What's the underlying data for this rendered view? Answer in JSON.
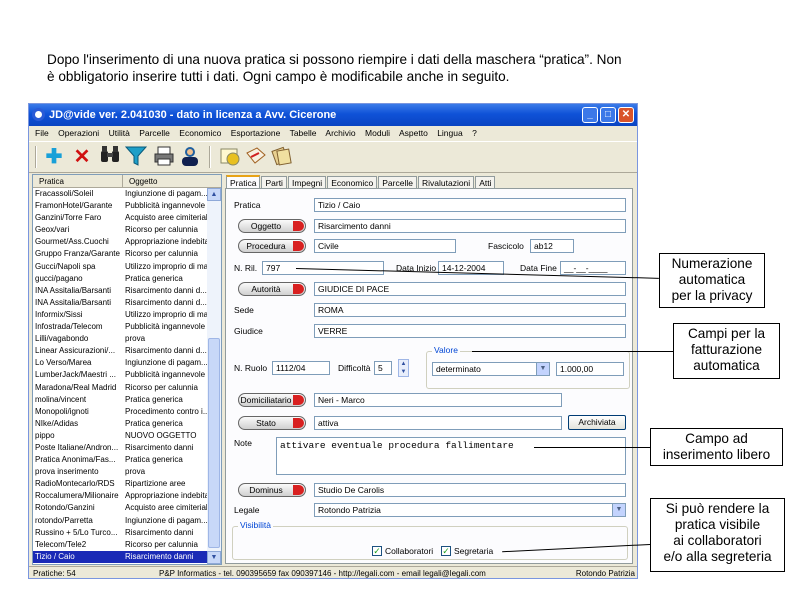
{
  "intro": {
    "line1": "Dopo l'inserimento di una nuova pratica si possono riempire i dati della maschera “pratica”. Non",
    "line2": "è obbligatorio inserire tutti i dati. Ogni campo è modificabile anche in seguito."
  },
  "window": {
    "title": "JD@vide ver. 2.041030 - dato in licenza a Avv. Cicerone",
    "menu": [
      "File",
      "Operazioni",
      "Utilità",
      "Parcelle",
      "Economico",
      "Esportazione",
      "Tabelle",
      "Archivio",
      "Moduli",
      "Aspetto",
      "Lingua",
      "?"
    ]
  },
  "toolbar": {
    "icons": [
      "add-icon",
      "delete-icon",
      "binoculars-icon",
      "filter-icon",
      "print-icon",
      "user-icon",
      "calendar-icon",
      "documents-icon",
      "notes-icon"
    ]
  },
  "list": {
    "headers": [
      "Pratica",
      "Oggetto"
    ],
    "rows": [
      [
        "Fracassoli/Soleil",
        "Ingiunzione di pagam..."
      ],
      [
        "FramonHotel/Garante",
        "Pubblicità ingannevole"
      ],
      [
        "Ganzini/Torre Faro",
        "Acquisto aree cimiteriali"
      ],
      [
        "Geox/vari",
        "Ricorso per calunnia"
      ],
      [
        "Gourmet/Ass.Cuochi",
        "Appropriazione indebita"
      ],
      [
        "Gruppo Franza/Garante",
        "Ricorso per calunnia"
      ],
      [
        "Gucci/Napoli spa",
        "Utilizzo improprio di mar..."
      ],
      [
        "gucci/pagano",
        "Pratica generica"
      ],
      [
        "INA Assitalia/Barsanti",
        "Risarcimento danni d..."
      ],
      [
        "INA Assitalia/Barsanti",
        "Risarcimento danni d..."
      ],
      [
        "Informix/Sissi",
        "Utilizzo improprio di mar..."
      ],
      [
        "Infostrada/Telecom",
        "Pubblicità ingannevole"
      ],
      [
        "Lilli/vagabondo",
        "prova"
      ],
      [
        "Linear Assicurazioni/...",
        "Risarcimento danni d..."
      ],
      [
        "Lo Verso/Marea",
        "Ingiunzione di pagam..."
      ],
      [
        "LumberJack/Maestri ...",
        "Pubblicità ingannevole"
      ],
      [
        "Maradona/Real Madrid",
        "Ricorso per calunnia"
      ],
      [
        "molina/vincent",
        "Pratica generica"
      ],
      [
        "Monopoli/ignoti",
        "Procedimento contro i..."
      ],
      [
        "NIke/Adidas",
        "Pratica generica"
      ],
      [
        "pippo",
        "NUOVO OGGETTO"
      ],
      [
        "Poste Italiane/Andron...",
        "Risarcimento danni"
      ],
      [
        "Pratica Anonima/Fas...",
        "Pratica generica"
      ],
      [
        "prova inserimento",
        "prova"
      ],
      [
        "RadioMontecarlo/RDS",
        "Ripartizione aree"
      ],
      [
        "Roccalumera/Milionaire",
        "Appropriazione indebita"
      ],
      [
        "Rotondo/Ganzini",
        "Acquisto aree cimiteriali"
      ],
      [
        "rotondo/Parretta",
        "Ingiunzione di pagam..."
      ],
      [
        "Russino + 5/Lo Turco...",
        "Risarcimento danni"
      ],
      [
        "Telecom/Tele2",
        "Ricorso per calunnia"
      ],
      [
        "Tizio / Caio",
        "Risarcimento danni"
      ]
    ]
  },
  "tabs": [
    "Pratica",
    "Parti",
    "Impegni",
    "Economico",
    "Parcelle",
    "Rivalutazioni",
    "Atti"
  ],
  "form": {
    "pratica_label": "Pratica",
    "pratica_value": "Tizio / Caio",
    "oggetto_btn": "Oggetto",
    "oggetto_value": "Risarcimento danni",
    "procedura_btn": "Procedura",
    "procedura_value": "Civile",
    "fascicolo_label": "Fascicolo",
    "fascicolo_value": "ab12",
    "nril_label": "N. Ril.",
    "nril_value": "797",
    "data_inizio_label": "Data Inizio",
    "data_inizio_value": "14-12-2004",
    "data_fine_label": "Data Fine",
    "data_fine_value": "__-__-____",
    "autorita_btn": "Autorità",
    "autorita_value": "GIUDICE DI PACE",
    "sede_label": "Sede",
    "sede_value": "ROMA",
    "giudice_label": "Giudice",
    "giudice_value": "VERRE",
    "valore_label": "Valore",
    "nruolo_label": "N. Ruolo",
    "nruolo_value": "1112/04",
    "difficolta_label": "Difficoltà",
    "difficolta_value": "5",
    "valore_tipo": "determinato",
    "valore_importo": "1.000,00",
    "domiciliatario_btn": "Domiciliatario",
    "domiciliatario_value": "Neri - Marco",
    "stato_btn": "Stato",
    "stato_value": "attiva",
    "archiviata_btn": "Archiviata",
    "note_label": "Note",
    "note_value": "attivare eventuale procedura fallimentare",
    "dominus_btn": "Dominus",
    "dominus_value": "Studio De Carolis",
    "legale_label": "Legale",
    "legale_value": "Rotondo Patrizia",
    "visibilita_label": "Visibilità",
    "collaboratori_label": "Collaboratori",
    "collaboratori_checked": true,
    "segretaria_label": "Segretaria",
    "segretaria_checked": true
  },
  "status": {
    "pratiche": "Pratiche: 54",
    "info": "P&P Informatics - tel. 090395659 fax 090397146 - http://legali.com - email legali@legali.com",
    "user": "Rotondo Patrizia"
  },
  "callouts": {
    "c1": [
      "Numerazione",
      "automatica",
      "per la privacy"
    ],
    "c2": [
      "Campi per la",
      "fatturazione",
      "automatica"
    ],
    "c3": [
      "Campo ad",
      "inserimento libero"
    ],
    "c4": [
      "Si può rendere la",
      "pratica visibile",
      "ai collaboratori",
      "e/o alla segreteria"
    ]
  },
  "colors": {
    "titlebar": "#0a44c2",
    "selected_row": "#1a2ab6",
    "button_red": "#d82020"
  }
}
